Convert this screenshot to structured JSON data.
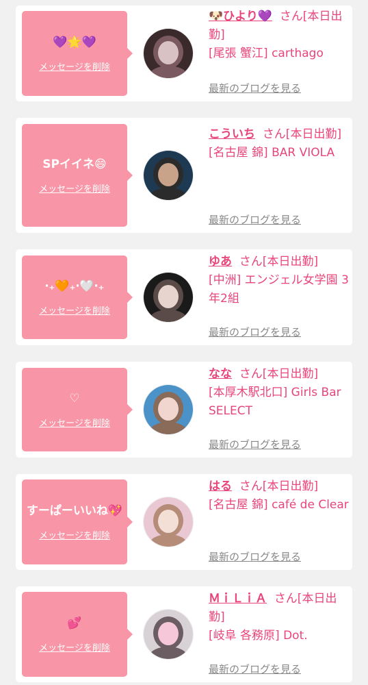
{
  "cards": [
    {
      "message": "💜🌟💜",
      "delete_label": "メッセージを削除",
      "name": "🐶ひより💜",
      "suffix": "さん[本日出勤]",
      "shop": "[尾張 蟹江] carthago",
      "blog_label": "最新のブログを見る",
      "avatar_colors": [
        "#3a2a2c",
        "#d9c2c4",
        "#7a5a60"
      ]
    },
    {
      "message": "SPイイネ😄",
      "delete_label": "メッセージを削除",
      "name": "こういち",
      "suffix": "さん[本日出勤]",
      "shop": "[名古屋 錦] BAR VIOLA",
      "blog_label": "最新のブログを見る",
      "avatar_colors": [
        "#1e3a52",
        "#c9a28a",
        "#2b2b2b"
      ]
    },
    {
      "message": "‧₊🧡₊‧🤍‧₊",
      "delete_label": "メッセージを削除",
      "name": "ゆあ",
      "suffix": "さん[本日出勤]",
      "shop": "[中洲] エンジェル女学園 3年2組",
      "blog_label": "最新のブログを見る",
      "avatar_colors": [
        "#1a1a1a",
        "#e7d4cf",
        "#5a4a48"
      ]
    },
    {
      "message": "♡",
      "delete_label": "メッセージを削除",
      "name": "なな",
      "suffix": "さん[本日出勤]",
      "shop": "[本厚木駅北口] Girls Bar SELECT",
      "blog_label": "最新のブログを見る",
      "avatar_colors": [
        "#4b92c8",
        "#f0d6cf",
        "#8a6a58"
      ]
    },
    {
      "message": "すーぱーいいね💖",
      "delete_label": "メッセージを削除",
      "name": "はる",
      "suffix": "さん[本日出勤]",
      "shop": "[名古屋 錦] café de Clear",
      "blog_label": "最新のブログを見る",
      "avatar_colors": [
        "#e9c8d3",
        "#f3dfd6",
        "#b58c78"
      ]
    },
    {
      "message": "💕",
      "delete_label": "メッセージを削除",
      "name": "ＭｉＬｉＡ",
      "suffix": "さん[本日出勤]",
      "shop": "[岐阜 各務原] Dot.",
      "blog_label": "最新のブログを見る",
      "avatar_colors": [
        "#d8d2d6",
        "#f5c7d8",
        "#6b5d62"
      ]
    }
  ],
  "colors": {
    "bubble": "#f895a6",
    "accent": "#e8457a",
    "link": "#888888",
    "page_bg": "#f1f1f1"
  }
}
